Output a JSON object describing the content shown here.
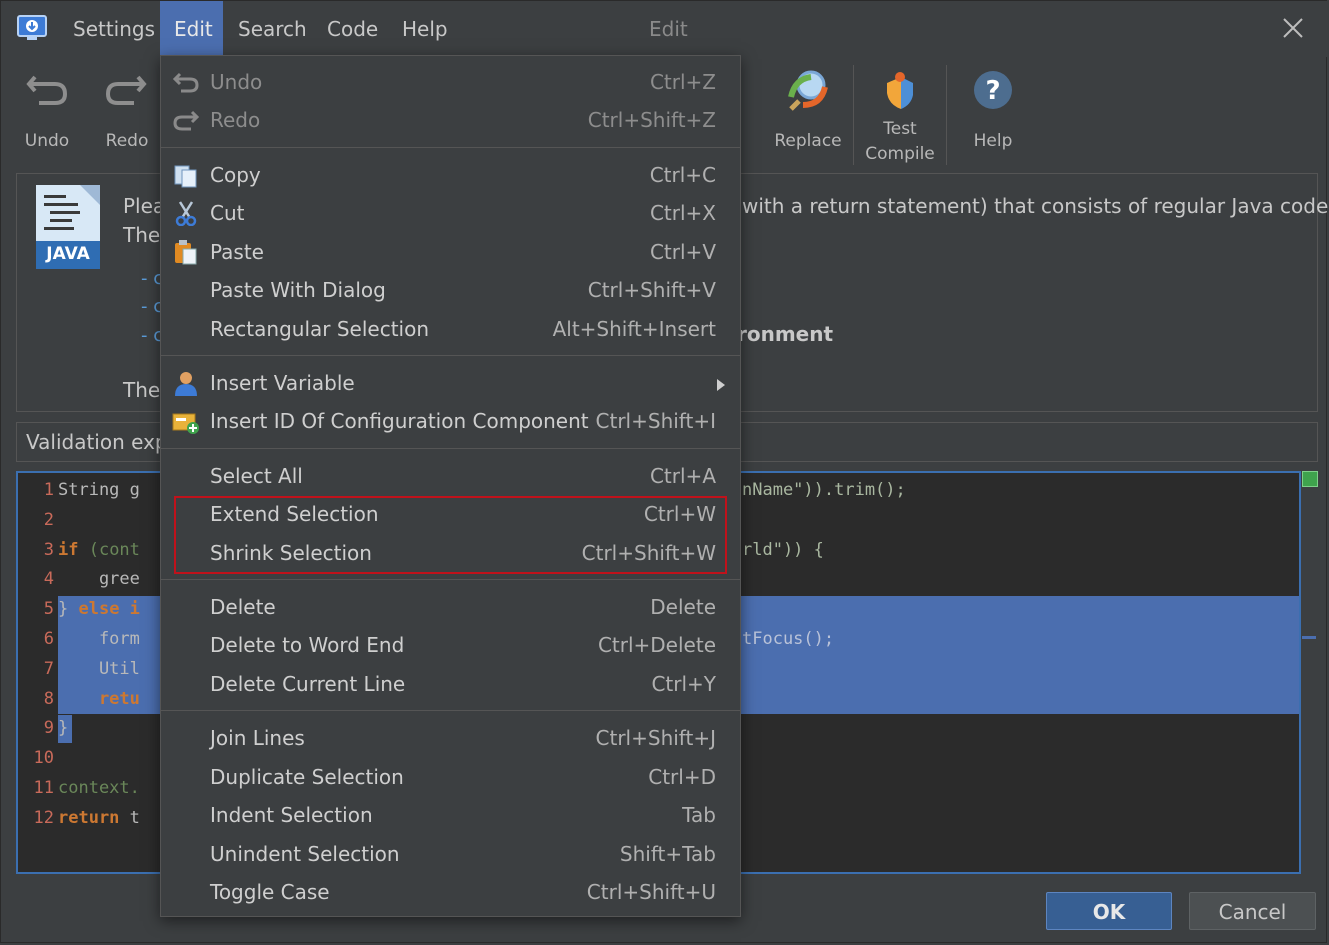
{
  "window": {
    "title": "Edit",
    "menubar": [
      "Settings",
      "Edit",
      "Search",
      "Code",
      "Help"
    ]
  },
  "toolbar": {
    "undo": "Undo",
    "redo": "Redo",
    "replace": "Replace",
    "test_compile_line1": "Test",
    "test_compile_line2": "Compile",
    "help": "Help"
  },
  "description": {
    "logo_text": "JAVA",
    "line1_left": "Plea",
    "line1_right": "with a return statement) that consists of regular Java code.",
    "line2_left": "The",
    "bullets": [
      "- c",
      "- c",
      "- c"
    ],
    "bold_right": "ronment",
    "line_bottom_left": "The"
  },
  "validation": {
    "label": "Validation exp"
  },
  "editor": {
    "lines": [
      {
        "n": "1",
        "left": "String g",
        "right": "nName\")).trim();"
      },
      {
        "n": "2",
        "left": "",
        "right": ""
      },
      {
        "n": "3",
        "left_kw": "if",
        "left_rest": " (cont",
        "right": "rld\")) {"
      },
      {
        "n": "4",
        "left": "    gree",
        "right": ""
      },
      {
        "n": "5",
        "left_pre": "} ",
        "left_kw": "else i",
        "right": ""
      },
      {
        "n": "6",
        "left": "    form",
        "right": "tFocus();"
      },
      {
        "n": "7",
        "left": "    Util",
        "right": ""
      },
      {
        "n": "8",
        "left_kw": "    retu",
        "right": ""
      },
      {
        "n": "9",
        "left": "}",
        "right": ""
      },
      {
        "n": "10",
        "left": "",
        "right": ""
      },
      {
        "n": "11",
        "left": "context.",
        "right": ""
      },
      {
        "n": "12",
        "left_kw": "return",
        "left_rest": " t",
        "right": ""
      }
    ]
  },
  "buttons": {
    "ok": "OK",
    "cancel": "Cancel"
  },
  "edit_menu": {
    "undo": {
      "label": "Undo",
      "shortcut": "Ctrl+Z"
    },
    "redo": {
      "label": "Redo",
      "shortcut": "Ctrl+Shift+Z"
    },
    "copy": {
      "label": "Copy",
      "shortcut": "Ctrl+C"
    },
    "cut": {
      "label": "Cut",
      "shortcut": "Ctrl+X"
    },
    "paste": {
      "label": "Paste",
      "shortcut": "Ctrl+V"
    },
    "paste_dialog": {
      "label": "Paste With Dialog",
      "shortcut": "Ctrl+Shift+V"
    },
    "rect_selection": {
      "label": "Rectangular Selection",
      "shortcut": "Alt+Shift+Insert"
    },
    "insert_variable": {
      "label": "Insert Variable",
      "shortcut": ""
    },
    "insert_id": {
      "label": "Insert ID Of Configuration Component",
      "shortcut": "Ctrl+Shift+I"
    },
    "select_all": {
      "label": "Select All",
      "shortcut": "Ctrl+A"
    },
    "extend_selection": {
      "label": "Extend Selection",
      "shortcut": "Ctrl+W"
    },
    "shrink_selection": {
      "label": "Shrink Selection",
      "shortcut": "Ctrl+Shift+W"
    },
    "delete": {
      "label": "Delete",
      "shortcut": "Delete"
    },
    "delete_word_end": {
      "label": "Delete to Word End",
      "shortcut": "Ctrl+Delete"
    },
    "delete_line": {
      "label": "Delete Current Line",
      "shortcut": "Ctrl+Y"
    },
    "join_lines": {
      "label": "Join Lines",
      "shortcut": "Ctrl+Shift+J"
    },
    "duplicate_selection": {
      "label": "Duplicate Selection",
      "shortcut": "Ctrl+D"
    },
    "indent_selection": {
      "label": "Indent Selection",
      "shortcut": "Tab"
    },
    "unindent_selection": {
      "label": "Unindent Selection",
      "shortcut": "Shift+Tab"
    },
    "toggle_case": {
      "label": "Toggle Case",
      "shortcut": "Ctrl+Shift+U"
    }
  },
  "colors": {
    "accent": "#4b6eaf",
    "highlight_border": "#c0121b",
    "background": "#3c3f41"
  }
}
